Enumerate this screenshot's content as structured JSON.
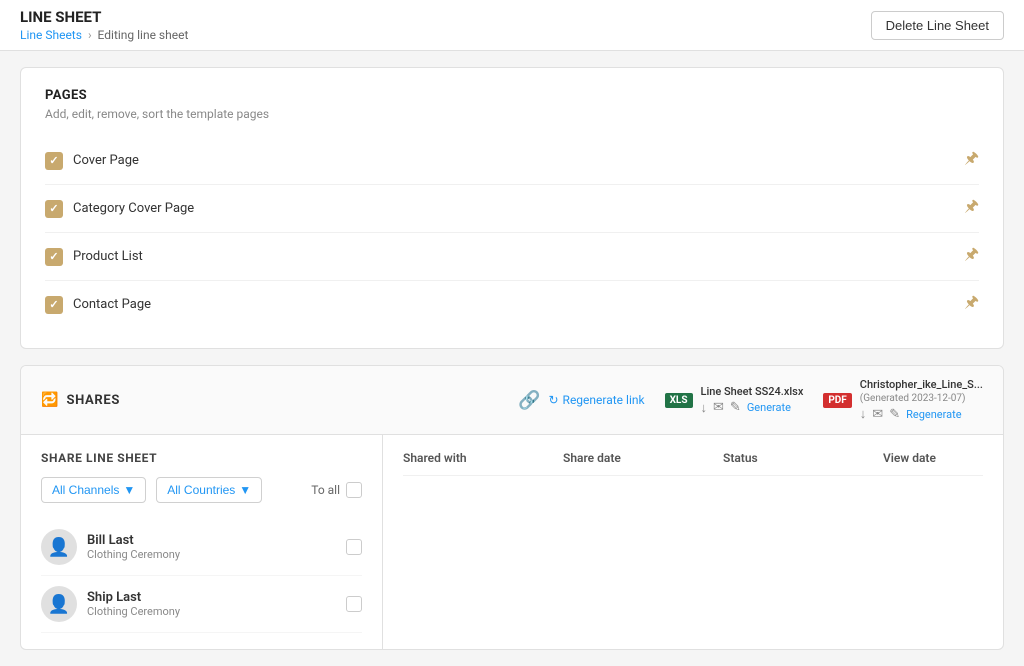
{
  "header": {
    "title": "LINE SHEET",
    "breadcrumb_link": "Line Sheets",
    "breadcrumb_sep": "›",
    "breadcrumb_current": "Editing line sheet",
    "delete_btn": "Delete Line Sheet"
  },
  "pages_section": {
    "title": "PAGES",
    "subtitle": "Add, edit, remove, sort the template pages",
    "items": [
      {
        "name": "Cover Page"
      },
      {
        "name": "Category Cover Page"
      },
      {
        "name": "Product List"
      },
      {
        "name": "Contact Page"
      }
    ]
  },
  "shares_section": {
    "title": "SHARES",
    "regenerate_label": "Regenerate link",
    "xlsx_file": "Line Sheet SS24.xlsx",
    "pdf_file": "Christopher_ike_Line_S...",
    "pdf_generated": "(Generated 2023-12-07)",
    "generate_label": "Generate",
    "regenerate_btn": "Regenerate",
    "share_title": "SHARE LINE SHEET",
    "filter_channels": "All Channels",
    "filter_countries": "All Countries",
    "to_all": "To all",
    "contacts": [
      {
        "name": "Bill Last",
        "company": "Clothing Ceremony"
      },
      {
        "name": "Ship Last",
        "company": "Clothing Ceremony"
      }
    ],
    "table_headers": [
      "Shared with",
      "Share date",
      "Status",
      "View date"
    ]
  }
}
